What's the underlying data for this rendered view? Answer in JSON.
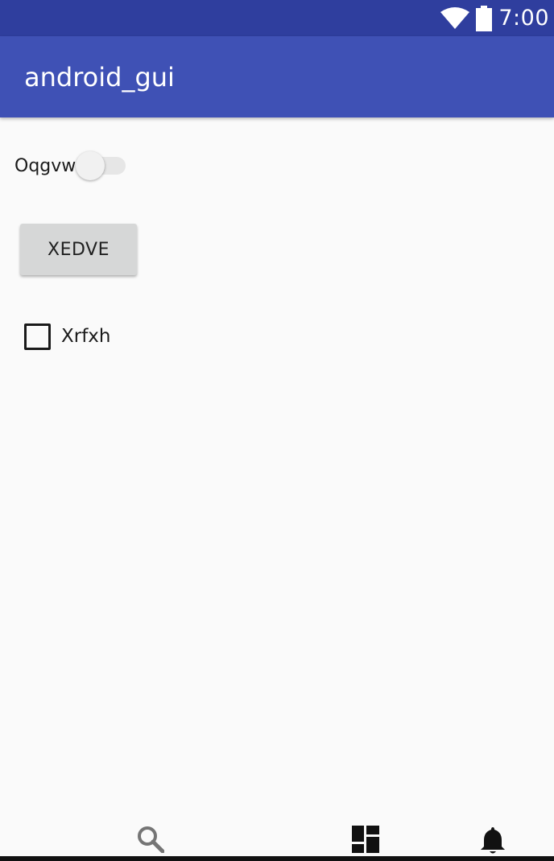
{
  "status_bar": {
    "time": "7:00",
    "icons": [
      "wifi-icon",
      "battery-icon"
    ],
    "color": "#2f3e9e"
  },
  "app_bar": {
    "title": "android_gui",
    "color": "#3f51b5"
  },
  "switch": {
    "label": "Oqgvw",
    "checked": false
  },
  "button": {
    "label": "XEDVE"
  },
  "checkbox": {
    "label": "Xrfxh",
    "checked": false
  },
  "bottom_icons": [
    "search-icon",
    "dashboard-icon",
    "notification-bell-icon"
  ]
}
